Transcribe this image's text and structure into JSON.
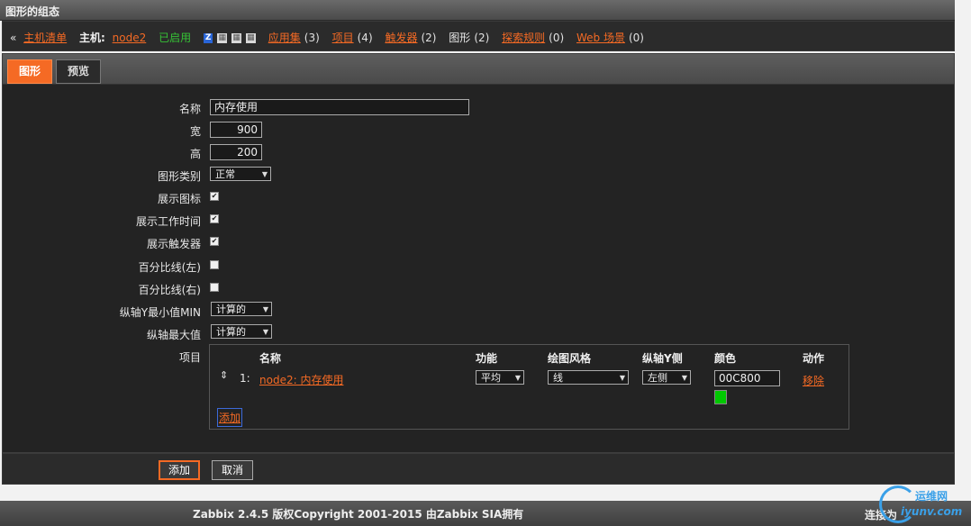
{
  "header": {
    "title": "图形的组态"
  },
  "host_bar": {
    "back_glyph": "«",
    "host_list_link": "主机清单",
    "host_label": "主机:",
    "host_name": "node2",
    "status": "已启用",
    "badge_z": "Z",
    "applications": {
      "label": "应用集",
      "count": "(3)"
    },
    "items": {
      "label": "项目",
      "count": "(4)"
    },
    "triggers": {
      "label": "触发器",
      "count": "(2)"
    },
    "graphs": {
      "label": "图形",
      "count": "(2)"
    },
    "discovery": {
      "label": "探索规则",
      "count": "(0)"
    },
    "web": {
      "label": "Web 场景",
      "count": "(0)"
    }
  },
  "tabs": [
    "图形",
    "预览"
  ],
  "form": {
    "name_label": "名称",
    "name_value": "内存使用",
    "width_label": "宽",
    "width_value": "900",
    "height_label": "高",
    "height_value": "200",
    "type_label": "图形类别",
    "type_value": "正常",
    "show_legend_label": "展示图标",
    "show_legend": true,
    "show_working_time_label": "展示工作时间",
    "show_working_time": true,
    "show_triggers_label": "展示触发器",
    "show_triggers": true,
    "percentile_left_label": "百分比线(左)",
    "percentile_left": false,
    "percentile_right_label": "百分比线(右)",
    "percentile_right": false,
    "ymin_label": "纵轴Y最小值MIN",
    "ymin_value": "计算的",
    "ymax_label": "纵轴最大值",
    "ymax_value": "计算的",
    "items_label": "项目"
  },
  "items_table": {
    "headers": [
      "名称",
      "功能",
      "绘图风格",
      "纵轴Y侧",
      "颜色",
      "动作"
    ],
    "rows": [
      {
        "index": "1:",
        "name": "node2: 内存使用",
        "function": "平均",
        "style": "线",
        "yaxis": "左侧",
        "color": "00C800",
        "color_hex": "#00c800",
        "action": "移除"
      }
    ],
    "add_link": "添加"
  },
  "buttons": {
    "add": "添加",
    "cancel": "取消"
  },
  "footer": {
    "copyright": "Zabbix 2.4.5 版权Copyright 2001-2015 由Zabbix SIA拥有",
    "connected": "连接为",
    "watermark_cn": "运维网",
    "watermark_en": "iyunv.com"
  },
  "colors": {
    "accent": "#f56a24",
    "enabled": "#36c236",
    "background": "#232323"
  }
}
